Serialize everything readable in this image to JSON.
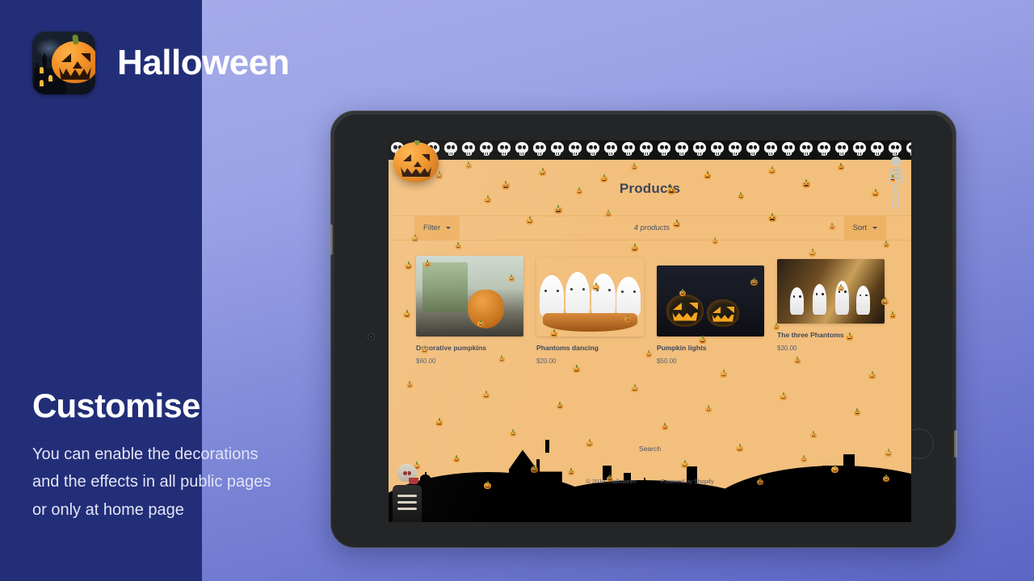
{
  "brand": {
    "title": "Halloween",
    "icon_name": "halloween-app-icon"
  },
  "copy": {
    "heading": "Customise",
    "body": "You can enable the decorations and the effects in all public pages or only at home page"
  },
  "device": {
    "type": "tablet",
    "orientation": "landscape"
  },
  "store": {
    "page_title": "Products",
    "filter_label": "Filter",
    "sort_label": "Sort",
    "product_count": "4 products",
    "products": [
      {
        "name": "Decorative pumpkins",
        "price": "$60.00",
        "image": "decorative-pumpkins-photo"
      },
      {
        "name": "Phantoms dancing",
        "price": "$20.00",
        "image": "phantoms-dancing-photo"
      },
      {
        "name": "Pumpkin lights",
        "price": "$50.00",
        "image": "pumpkin-lights-photo"
      },
      {
        "name": "The three Phantoms",
        "price": "$30.00",
        "image": "three-phantoms-photo"
      }
    ],
    "footer": {
      "search_label": "Search",
      "copyright": "© 2019, Halloween",
      "powered_by": "Powered by Shopify"
    },
    "decorations": {
      "top_border": "skull-border",
      "header_pumpkin": "jack-o-lantern",
      "right_figure": "hanging-skeleton",
      "falling_items": "pumpkin-emoji-rain",
      "footer_scene": "graveyard-silhouette",
      "footer_figure": "zombie-skeleton"
    }
  },
  "colors": {
    "panel_dark": "#232e78",
    "bg_top": "#a7adea",
    "bg_bottom": "#5b66c4",
    "store_bg": "#f2bf7d",
    "store_accent": "#eeb264",
    "store_text": "#3f4757"
  }
}
